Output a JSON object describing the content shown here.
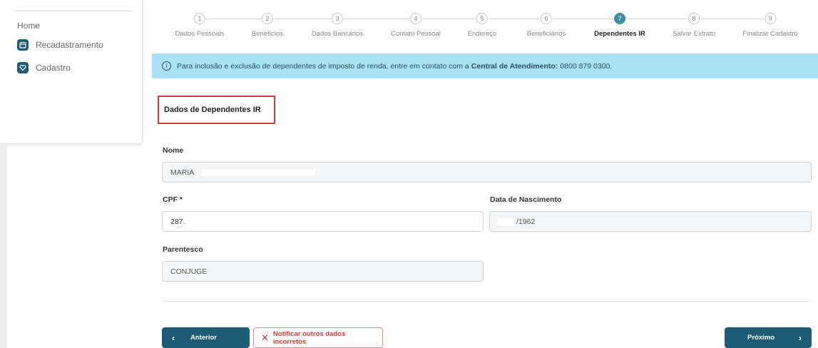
{
  "sidebar": {
    "items": [
      {
        "label": "Home"
      },
      {
        "label": "Recadastramento",
        "icon": "calendar-icon"
      },
      {
        "label": "Cadastro",
        "icon": "heart-icon"
      }
    ]
  },
  "stepper": {
    "steps": [
      {
        "num": "1",
        "label": "Dados Pessoais"
      },
      {
        "num": "2",
        "label": "Benefícios"
      },
      {
        "num": "3",
        "label": "Dados Bancários"
      },
      {
        "num": "4",
        "label": "Contato Pessoal"
      },
      {
        "num": "5",
        "label": "Endereço"
      },
      {
        "num": "6",
        "label": "Beneficiários"
      },
      {
        "num": "7",
        "label": "Dependentes IR"
      },
      {
        "num": "8",
        "label": "Salvar Extrato"
      },
      {
        "num": "9",
        "label": "Finalizar Cadastro"
      }
    ],
    "active": 7
  },
  "alert": {
    "text_before": "Para inclusão e exclusão de dependentes de imposto de renda, entre em contato com a",
    "bold": "Central de Atendimento:",
    "text_after": "0800 879 0300."
  },
  "section": {
    "title": "Dados de Dependentes IR"
  },
  "form": {
    "nome_label": "Nome",
    "nome_value": "MARIA",
    "cpf_label": "CPF *",
    "cpf_value": "287.",
    "nascimento_label": "Data de Nascimento",
    "nascimento_value": "/1962",
    "parentesco_label": "Parentesco",
    "parentesco_value": "CONJUGE"
  },
  "buttons": {
    "prev": "Anterior",
    "notify": "Notificar outros dados incorretos",
    "next": "Próximo"
  },
  "colors": {
    "primary": "#1d5c74",
    "step_active": "#3f8ca5",
    "alert_bg": "#a9e1f7",
    "danger": "#d53a3a"
  }
}
